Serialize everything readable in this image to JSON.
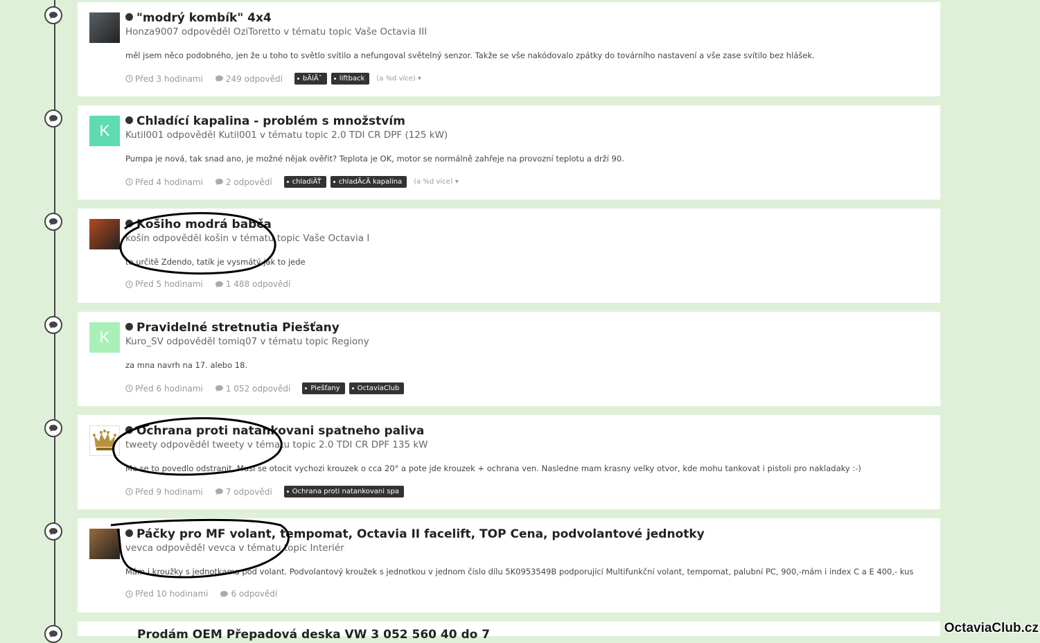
{
  "posts": [
    {
      "title": "\"modrý kombík\" 4x4",
      "byline": "Honza9007 odpověděl OziToretto v tématu topic Vaše Octavia III",
      "excerpt": "měl jsem něco podobného, jen že u toho to světlo svítilo a nefungoval světelný senzor. Takže se vše nakódovalo zpátky do továrního nastavení a vše zase svítilo bez hlášek.",
      "time": "Před 3 hodinami",
      "replies": "249 odpovědí",
      "tags": [
        "bÃlÃ˘",
        "liftback"
      ],
      "more": "(a %d více)",
      "avatar": {
        "type": "photo",
        "color": "#5a6066"
      }
    },
    {
      "title": "Chladící kapalina - problém s množstvím",
      "byline": "Kutil001 odpověděl Kutil001 v tématu topic 2.0 TDI CR DPF (125 kW)",
      "excerpt": "Pumpa je nová, tak snad ano, je možné nějak ověřit? Teplota je OK, motor se normálně zahřeje na provozní teplotu a drží 90.",
      "time": "Před 4 hodinami",
      "replies": "2 odpovědí",
      "tags": [
        "chladiÃŤ",
        "chladÃcÃ kapalina"
      ],
      "more": "(a %d více)",
      "avatar": {
        "type": "letter",
        "letter": "K",
        "color": "#5fdbb0"
      }
    },
    {
      "title": "Košiho modrá babča",
      "byline": "košin odpověděl košin v tématu topic Vaše Octavia I",
      "excerpt": "to určitě Zdendo, tatík je vysmátý jak to jede",
      "time": "Před 5 hodinami",
      "replies": "1 488 odpovědí",
      "tags": [],
      "more": "",
      "avatar": {
        "type": "photo",
        "color": "#b34a1e"
      }
    },
    {
      "title": "Pravidelné stretnutia Piešťany",
      "byline": "Kuro_SV odpověděl tomiq07 v tématu topic Regiony",
      "excerpt": "za mna navrh na 17. alebo 18.",
      "time": "Před 6 hodinami",
      "replies": "1 052 odpovědí",
      "tags": [
        "Piešťany",
        "OctaviaClub"
      ],
      "more": "",
      "avatar": {
        "type": "letter",
        "letter": "K",
        "color": "#a8f0b8"
      }
    },
    {
      "title": "Ochrana proti natankovani spatneho paliva",
      "byline": "tweety odpověděl tweety v tématu topic 2.0 TDI CR DPF 135 kW",
      "excerpt": "Me se to povedlo odstranit. Musi se otocit vychozi krouzek o cca 20° a pote jde krouzek + ochrana ven. Nasledne mam krasny velky otvor, kde mohu tankovat i pistoli pro nakladaky :-)",
      "time": "Před 9 hodinami",
      "replies": "7 odpovědí",
      "tags": [
        "Ochrana proti natankovani spa"
      ],
      "more": "",
      "avatar": {
        "type": "crown",
        "color": "#ffffff"
      }
    },
    {
      "title": "Páčky pro MF volant, tempomat, Octavia II facelift, TOP Cena, podvolantové jednotky",
      "byline": "vevca odpověděl vevca v tématu topic Interiér",
      "excerpt": "Mám i kroužky s jednotkama pod volant. Podvolantový kroužek s jednotkou v jednom číslo dílu 5K0953549B podporující Multifunkční volant, tempomat, palubní PC, 900,-mám i index C a E 400,- kus",
      "time": "Před 10 hodinami",
      "replies": "6 odpovědí",
      "tags": [],
      "more": "",
      "avatar": {
        "type": "photo",
        "color": "#9a6a3a"
      }
    }
  ],
  "partial_next_title": "Prodám OEM Přepadová deska VW 3 052 560 40 do 7",
  "watermark": "OctaviaClub.cz",
  "colors": {
    "background": "#dff0d8",
    "card": "#ffffff",
    "tag": "#333333"
  }
}
